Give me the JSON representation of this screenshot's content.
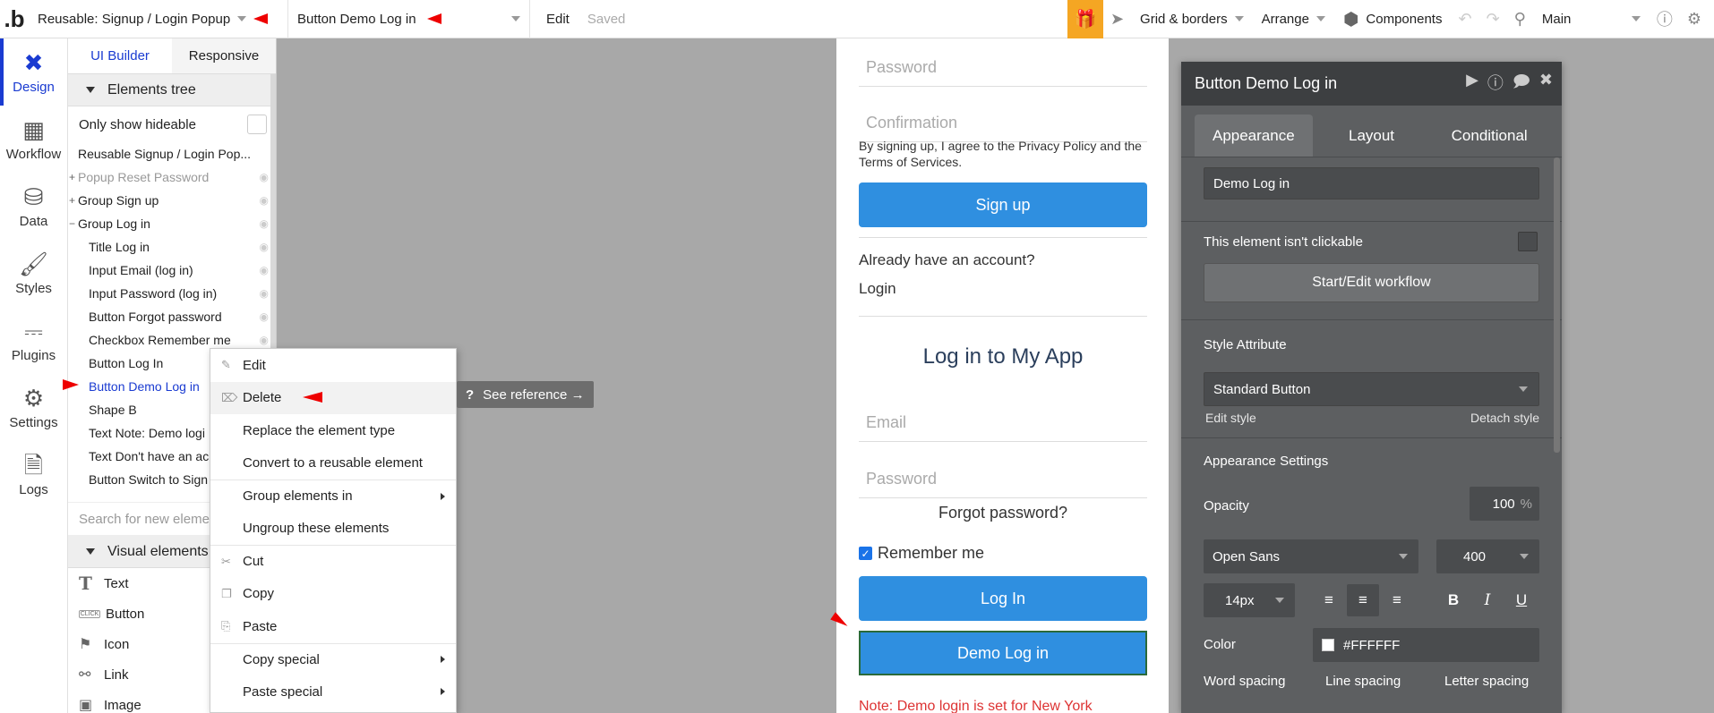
{
  "topbar": {
    "page_selector": "Reusable: Signup / Login Popup",
    "element_selector": "Button Demo Log in",
    "edit_label": "Edit",
    "saved_label": "Saved",
    "grid_label": "Grid & borders",
    "arrange_label": "Arrange",
    "components_label": "Components",
    "branch_label": "Main"
  },
  "leftnav": [
    {
      "label": "Design",
      "icon": "design-icon"
    },
    {
      "label": "Workflow",
      "icon": "workflow-icon"
    },
    {
      "label": "Data",
      "icon": "database-icon"
    },
    {
      "label": "Styles",
      "icon": "brush-icon"
    },
    {
      "label": "Plugins",
      "icon": "plug-icon"
    },
    {
      "label": "Settings",
      "icon": "gear-icon"
    },
    {
      "label": "Logs",
      "icon": "document-icon"
    }
  ],
  "sidepanel": {
    "tabs": [
      "UI Builder",
      "Responsive"
    ],
    "tree_title": "Elements tree",
    "only_hideable": "Only show hideable",
    "tree": [
      {
        "label": "Reusable Signup / Login Pop...",
        "indent": 0,
        "pm": "",
        "dim": false
      },
      {
        "label": "Popup Reset Password",
        "indent": 0,
        "pm": "+",
        "dim": true
      },
      {
        "label": "Group Sign up",
        "indent": 0,
        "pm": "+",
        "dim": false
      },
      {
        "label": "Group Log in",
        "indent": 0,
        "pm": "−",
        "dim": false
      },
      {
        "label": "Title Log in",
        "indent": 1,
        "pm": "",
        "dim": false
      },
      {
        "label": "Input Email (log in)",
        "indent": 1,
        "pm": "",
        "dim": false
      },
      {
        "label": "Input Password (log in)",
        "indent": 1,
        "pm": "",
        "dim": false
      },
      {
        "label": "Button Forgot password",
        "indent": 1,
        "pm": "",
        "dim": false
      },
      {
        "label": "Checkbox Remember me",
        "indent": 1,
        "pm": "",
        "dim": false
      },
      {
        "label": "Button Log In",
        "indent": 1,
        "pm": "",
        "dim": false
      },
      {
        "label": "Button Demo Log in",
        "indent": 1,
        "pm": "",
        "dim": false,
        "selected": true
      },
      {
        "label": "Shape B",
        "indent": 1,
        "pm": "",
        "dim": false
      },
      {
        "label": "Text Note: Demo logi",
        "indent": 1,
        "pm": "",
        "dim": false
      },
      {
        "label": "Text Don't have an ac",
        "indent": 1,
        "pm": "",
        "dim": false
      },
      {
        "label": "Button Switch to Sign",
        "indent": 1,
        "pm": "",
        "dim": false
      }
    ],
    "search_placeholder": "Search for new eleme",
    "visual_title": "Visual elements",
    "visual_items": [
      {
        "label": "Text",
        "icon": "T"
      },
      {
        "label": "Button",
        "icon": "CLICK"
      },
      {
        "label": "Icon",
        "icon": "⚑"
      },
      {
        "label": "Link",
        "icon": "⚯"
      },
      {
        "label": "Image",
        "icon": "▣"
      }
    ]
  },
  "context_menu": [
    {
      "label": "Edit",
      "icon": "✎"
    },
    {
      "label": "Delete",
      "icon": "⌦",
      "hover": true
    },
    {
      "label": "Replace the element type"
    },
    {
      "label": "Convert to a reusable element"
    },
    {
      "label": "Group elements in",
      "submenu": true,
      "sep": true
    },
    {
      "label": "Ungroup these elements"
    },
    {
      "label": "Cut",
      "icon": "✂",
      "sep": true
    },
    {
      "label": "Copy",
      "icon": "❐"
    },
    {
      "label": "Paste",
      "icon": "⎘"
    },
    {
      "label": "Copy special",
      "submenu": true,
      "sep": true
    },
    {
      "label": "Paste special",
      "submenu": true
    }
  ],
  "see_reference": "See reference →",
  "page": {
    "password_placeholder": "Password",
    "confirmation_placeholder": "Confirmation",
    "terms": "By signing up, I agree to the Privacy Policy and the Terms of Services.",
    "signup_button": "Sign up",
    "already_account": "Already have an account?",
    "login_link": "Login",
    "login_title": "Log in to My App",
    "email_placeholder": "Email",
    "password2_placeholder": "Password",
    "forgot": "Forgot password?",
    "remember": "Remember me",
    "login_button": "Log In",
    "demo_button": "Demo Log in",
    "note": "Note: Demo login is set for New York"
  },
  "property_editor": {
    "title": "Button Demo Log in",
    "tabs": [
      "Appearance",
      "Layout",
      "Conditional"
    ],
    "text_value": "Demo Log in",
    "not_clickable": "This element isn't clickable",
    "workflow_button": "Start/Edit workflow",
    "style_attribute": "Style Attribute",
    "style_value": "Standard Button",
    "edit_style": "Edit style",
    "detach_style": "Detach style",
    "appearance_settings": "Appearance Settings",
    "opacity_label": "Opacity",
    "opacity_value": "100",
    "opacity_unit": "%",
    "font_family": "Open Sans",
    "font_weight": "400",
    "font_size": "14px",
    "color_label": "Color",
    "color_value": "#FFFFFF",
    "word_spacing": "Word spacing",
    "line_spacing": "Line spacing",
    "letter_spacing": "Letter spacing"
  },
  "colors": {
    "accent": "#1a3bd1",
    "button_blue": "#2f8fe0",
    "gift": "#f5a623",
    "note_red": "#d33333"
  }
}
